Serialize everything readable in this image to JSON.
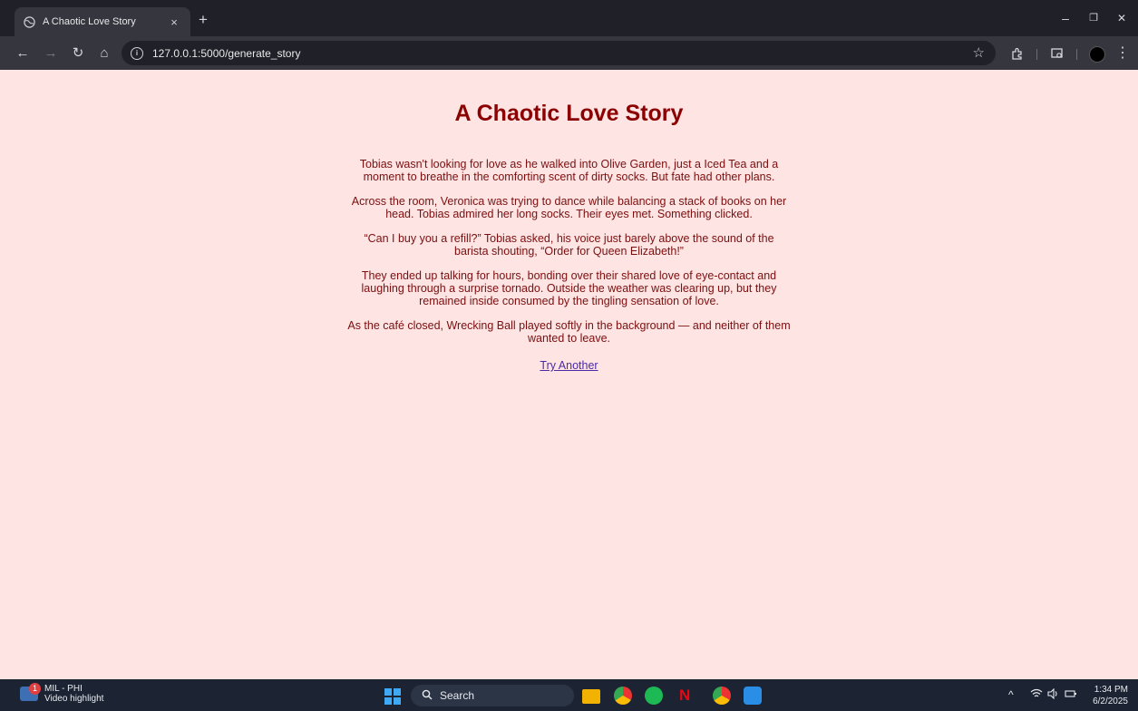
{
  "browser": {
    "tab_title": "A Chaotic Love Story",
    "tab_close": "×",
    "new_tab": "+",
    "url": "127.0.0.1:5000/generate_story",
    "window_controls": {
      "minimize": "–",
      "restore": "❐",
      "close": "✕"
    },
    "nav": {
      "back": "←",
      "forward": "→",
      "reload": "↻",
      "home": "⌂"
    },
    "info_icon": "i",
    "bookmark_icon": "☆",
    "extensions_icon": "puzzle-icon",
    "reading_icon": "tab-search-icon",
    "menu_icon": "⋮"
  },
  "page": {
    "title": "A Chaotic Love Story",
    "paragraphs": [
      "Tobias wasn't looking for love as he walked into Olive Garden, just a Iced Tea and a moment to breathe in the comforting scent of dirty socks. But fate had other plans.",
      "Across the room, Veronica was trying to dance while balancing a stack of books on her head. Tobias admired her long socks. Their eyes met. Something clicked.",
      "“Can I buy you a refill?” Tobias asked, his voice just barely above the sound of the barista shouting, “Order for Queen Elizabeth!”",
      "They ended up talking for hours, bonding over their shared love of eye-contact and laughing through a surprise tornado. Outside the weather was clearing up, but they remained inside consumed by the tingling sensation of love.",
      "As the café closed, Wrecking Ball played softly in the background — and neither of them wanted to leave."
    ],
    "link_label": "Try Another",
    "colors": {
      "background": "#ffe4e4",
      "title": "#8b0000",
      "text": "#7a0f0f",
      "link": "#4b2aa8"
    }
  },
  "taskbar": {
    "widget_badge": "1",
    "widget_line1": "MIL - PHI",
    "widget_line2": "Video highlight",
    "search_label": "Search",
    "tray_chevron": "^",
    "time": "1:34 PM",
    "date": "6/2/2025"
  }
}
